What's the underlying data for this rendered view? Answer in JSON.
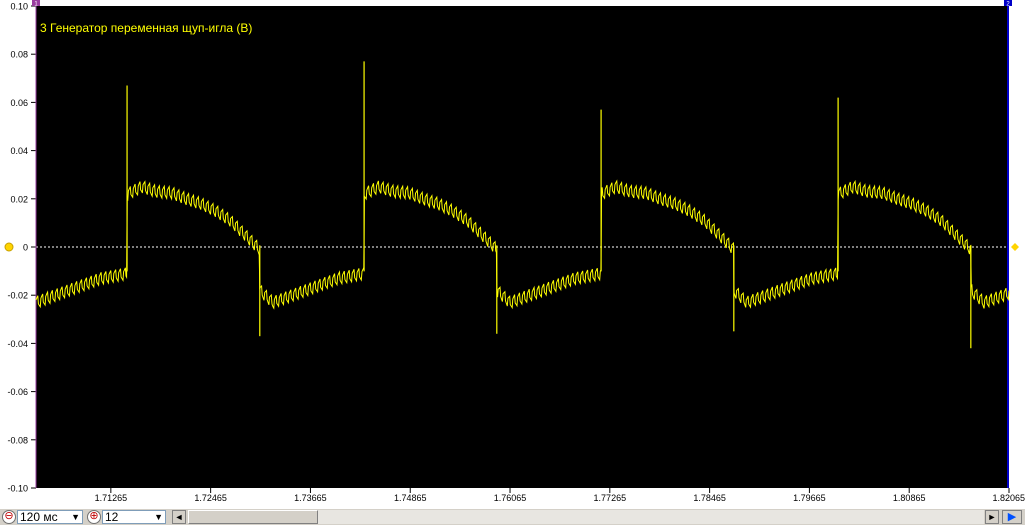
{
  "chart_data": {
    "type": "line",
    "title": "3 Генератор переменная щуп-игла (В)",
    "ylim": [
      -0.1,
      0.1
    ],
    "yticks": [
      "0.10",
      "0.08",
      "0.06",
      "0.04",
      "0.02",
      "0",
      "-0.02",
      "-0.04",
      "-0.06",
      "-0.08",
      "-0.10"
    ],
    "xlim": [
      1.70365,
      1.82065
    ],
    "xtick_values": [
      1.71265,
      1.72465,
      1.73665,
      1.74865,
      1.76065,
      1.77265,
      1.78465,
      1.79665,
      1.80865,
      1.82065
    ],
    "xticks": [
      "1.71265",
      "1.72465",
      "1.73665",
      "1.74865",
      "1.76065",
      "1.77265",
      "1.78465",
      "1.79665",
      "1.80865",
      "1.82065"
    ],
    "series": [
      {
        "color": "#ffff00",
        "period": 0.0285,
        "first_rise": 1.7146,
        "high_level": [
          0.023,
          0.026,
          0.024,
          0.0235,
          0.021,
          0.019,
          0.016,
          0.012,
          0.006,
          0.0
        ],
        "low_level": [
          -0.017,
          -0.022,
          -0.02,
          -0.018,
          -0.016,
          -0.014,
          -0.012,
          -0.011,
          -0.01
        ],
        "ripple_amplitude": 0.004,
        "positive_spike_peaks": [
          0.067,
          0.077,
          0.057,
          0.062,
          0.027
        ],
        "negative_spike_peaks": [
          -0.037,
          -0.036,
          -0.035,
          -0.042
        ]
      }
    ],
    "zero_line": "dashed white",
    "grid": false,
    "cursor_markers": [
      "1",
      "2"
    ]
  },
  "toolbar": {
    "timebase_label": "120 мс",
    "channel_label": "12",
    "zoom_out_icon": "⊖",
    "zoom_in_icon": "⊕",
    "scroll_left": "◄",
    "scroll_right": "►",
    "play_icon": "▶"
  }
}
